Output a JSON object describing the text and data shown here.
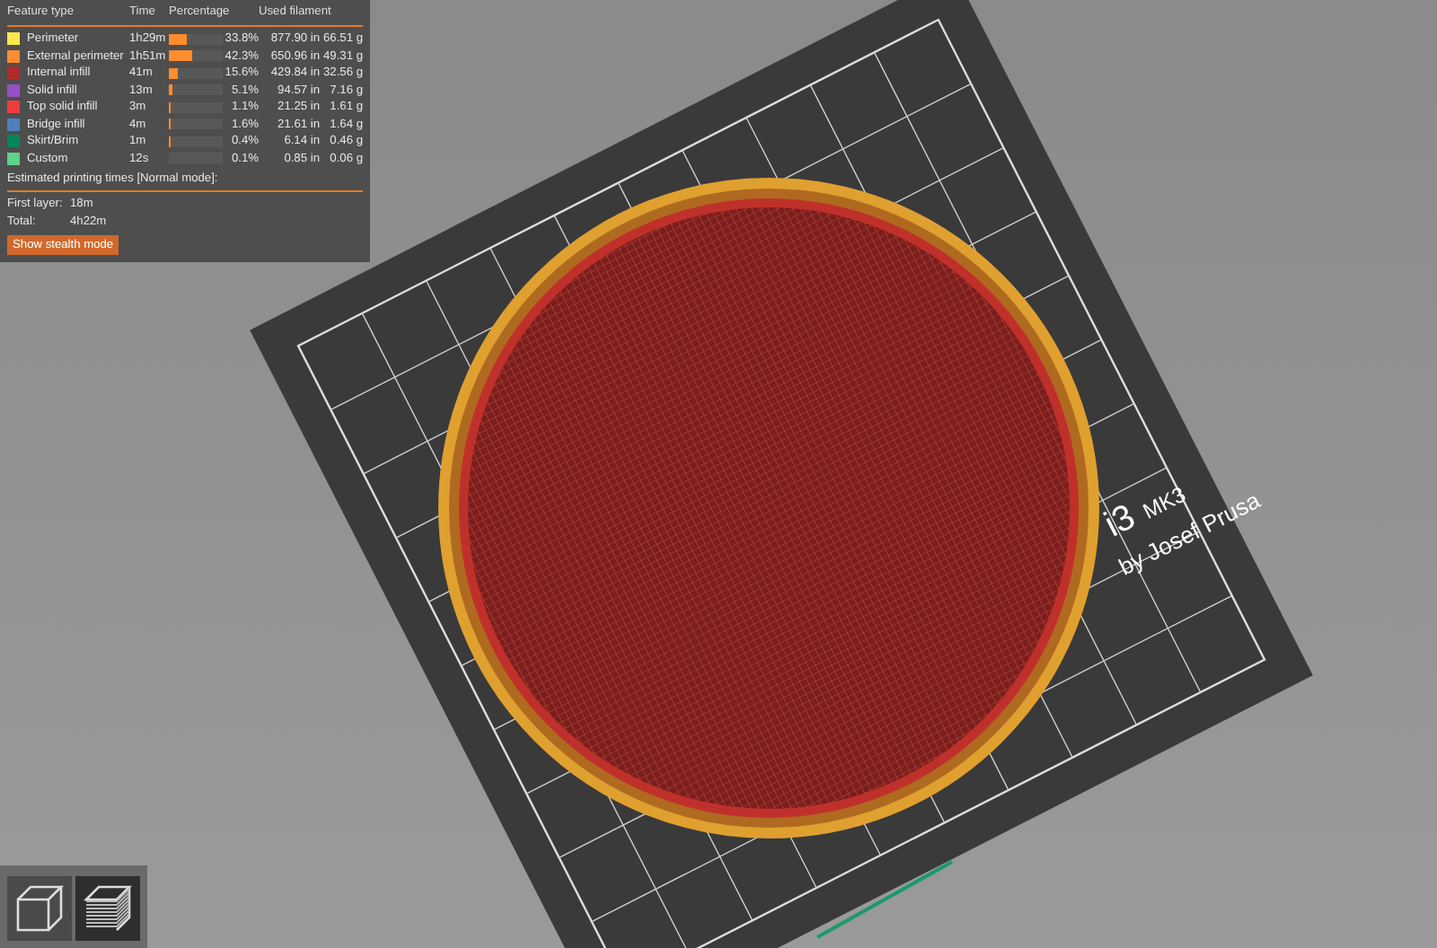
{
  "legend": {
    "columns": [
      "Feature type",
      "Time",
      "Percentage",
      "Used filament"
    ],
    "rows": [
      {
        "name": "Perimeter",
        "color": "#ffe94d",
        "time": "1h29m",
        "level": 0.338,
        "percentage": "33.8%",
        "length": "877.90 in",
        "weight": "66.51 g"
      },
      {
        "name": "External perimeter",
        "color": "#ff8d2e",
        "time": "1h51m",
        "level": 0.423,
        "percentage": "42.3%",
        "length": "650.96 in",
        "weight": "49.31 g"
      },
      {
        "name": "Internal infill",
        "color": "#b3292a",
        "time": "41m",
        "level": 0.156,
        "percentage": "15.6%",
        "length": "429.84 in",
        "weight": "32.56 g"
      },
      {
        "name": "Solid infill",
        "color": "#9650c8",
        "time": "13m",
        "level": 0.051,
        "percentage": "5.1%",
        "length": "94.57 in",
        "weight": "7.16 g"
      },
      {
        "name": "Top solid infill",
        "color": "#f03c3c",
        "time": "3m",
        "level": 0.011,
        "percentage": "1.1%",
        "length": "21.25 in",
        "weight": "1.61 g"
      },
      {
        "name": "Bridge infill",
        "color": "#4d80ba",
        "time": "4m",
        "level": 0.016,
        "percentage": "1.6%",
        "length": "21.61 in",
        "weight": "1.64 g"
      },
      {
        "name": "Skirt/Brim",
        "color": "#00875a",
        "time": "1m",
        "level": 0.004,
        "percentage": "0.4%",
        "length": "6.14 in",
        "weight": "0.46 g"
      },
      {
        "name": "Custom",
        "color": "#5ed18a",
        "time": "12s",
        "level": 0.001,
        "percentage": "0.1%",
        "length": "0.85 in",
        "weight": "0.06 g"
      }
    ],
    "estimate_title": "Estimated printing times [Normal mode]:",
    "times": [
      {
        "label": "First layer:",
        "value": "18m"
      },
      {
        "label": "Total:",
        "value": "4h22m"
      }
    ],
    "stealth_button": "Show stealth mode"
  },
  "bed_labels": [
    "i3",
    "MK3",
    "by Josef Prusa"
  ],
  "view_buttons": [
    {
      "kind": "cube",
      "selected": false
    },
    {
      "kind": "layers",
      "selected": true
    }
  ]
}
